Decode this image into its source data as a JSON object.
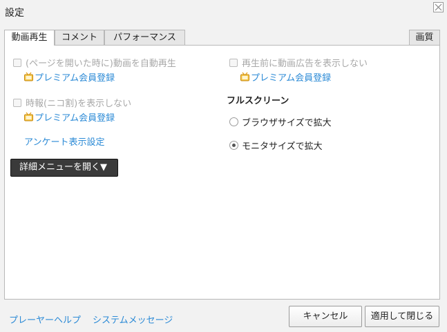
{
  "window": {
    "title": "設定"
  },
  "tabs": [
    {
      "label": "動画再生",
      "active": true
    },
    {
      "label": "コメント",
      "active": false
    },
    {
      "label": "パフォーマンス",
      "active": false
    }
  ],
  "right_tab": {
    "label": "画質"
  },
  "left_column": {
    "autoplay_label": "(ページを開いた時に)動画を自動再生",
    "premium_link_1": "プレミアム会員登録",
    "timesignal_label": "時報(ニコ割)を表示しない",
    "premium_link_2": "プレミアム会員登録",
    "survey_link": "アンケート表示設定",
    "detail_menu_button": "詳細メニューを開く▼"
  },
  "right_column": {
    "hide_ads_label": "再生前に動画広告を表示しない",
    "premium_link_3": "プレミアム会員登録",
    "fullscreen_title": "フルスクリーン",
    "fullscreen_options": [
      {
        "label": "ブラウザサイズで拡大",
        "selected": false
      },
      {
        "label": "モニタサイズで拡大",
        "selected": true
      }
    ]
  },
  "footer": {
    "help_link": "プレーヤーヘルプ",
    "system_message_link": "システムメッセージ",
    "cancel_button": "キャンセル",
    "apply_close_button": "適用して閉じる"
  },
  "colors": {
    "link": "#2b8ad6",
    "disabled": "#a8a8a8",
    "menu_button_bg": "#3a3a3a",
    "premium_icon": "#e8a21a"
  }
}
